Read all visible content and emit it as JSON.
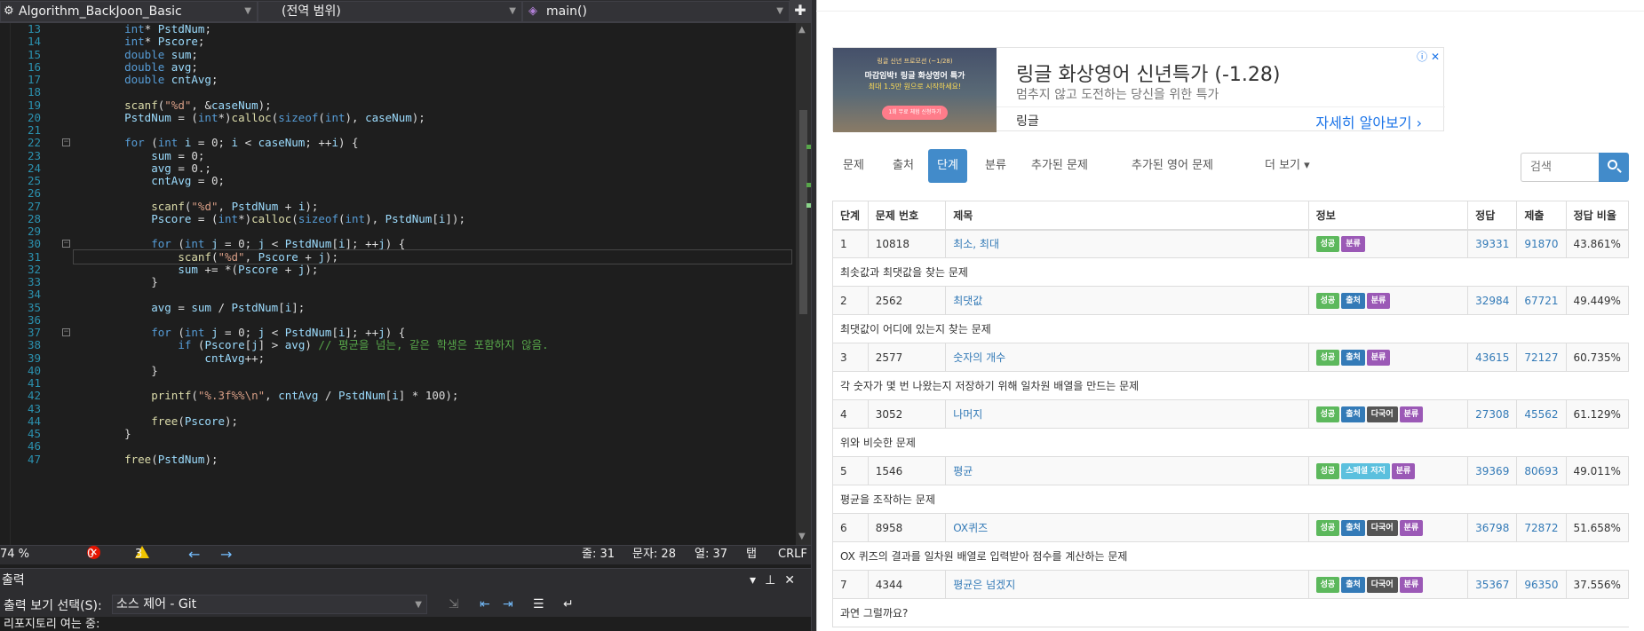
{
  "ide": {
    "nav": {
      "project": "Algorithm_BackJoon_Basic",
      "scope": "(전역 범위)",
      "func": "main()"
    },
    "code_lines": [
      {
        "n": "13",
        "t": "    int* PstdNum;"
      },
      {
        "n": "14",
        "t": "    int* Pscore;"
      },
      {
        "n": "15",
        "t": "    double sum;"
      },
      {
        "n": "16",
        "t": "    double avg;"
      },
      {
        "n": "17",
        "t": "    double cntAvg;"
      },
      {
        "n": "18",
        "t": ""
      },
      {
        "n": "19",
        "t": "    scanf(\"%d\", &caseNum);"
      },
      {
        "n": "20",
        "t": "    PstdNum = (int*)calloc(sizeof(int), caseNum);"
      },
      {
        "n": "21",
        "t": ""
      },
      {
        "n": "22",
        "t": "    for (int i = 0; i < caseNum; ++i) {"
      },
      {
        "n": "23",
        "t": "        sum = 0;"
      },
      {
        "n": "24",
        "t": "        avg = 0.;"
      },
      {
        "n": "25",
        "t": "        cntAvg = 0;"
      },
      {
        "n": "26",
        "t": ""
      },
      {
        "n": "27",
        "t": "        scanf(\"%d\", PstdNum + i);"
      },
      {
        "n": "28",
        "t": "        Pscore = (int*)calloc(sizeof(int), PstdNum[i]);"
      },
      {
        "n": "29",
        "t": ""
      },
      {
        "n": "30",
        "t": "        for (int j = 0; j < PstdNum[i]; ++j) {"
      },
      {
        "n": "31",
        "t": "            scanf(\"%d\", Pscore + j);"
      },
      {
        "n": "32",
        "t": "            sum += *(Pscore + j);"
      },
      {
        "n": "33",
        "t": "        }"
      },
      {
        "n": "34",
        "t": ""
      },
      {
        "n": "35",
        "t": "        avg = sum / PstdNum[i];"
      },
      {
        "n": "36",
        "t": ""
      },
      {
        "n": "37",
        "t": "        for (int j = 0; j < PstdNum[i]; ++j) {"
      },
      {
        "n": "38",
        "t": "            if (Pscore[j] > avg) // 평균을 넘는, 같은 학생은 포함하지 않음."
      },
      {
        "n": "39",
        "t": "                cntAvg++;"
      },
      {
        "n": "40",
        "t": "        }"
      },
      {
        "n": "41",
        "t": ""
      },
      {
        "n": "42",
        "t": "        printf(\"%.3f%%\\n\", cntAvg / PstdNum[i] * 100);"
      },
      {
        "n": "43",
        "t": ""
      },
      {
        "n": "44",
        "t": "        free(Pscore);"
      },
      {
        "n": "45",
        "t": "    }"
      },
      {
        "n": "46",
        "t": ""
      },
      {
        "n": "47",
        "t": "    free(PstdNum);"
      }
    ],
    "status": {
      "zoom": "74 %",
      "errors": "0",
      "warnings": "3",
      "line": "줄: 31",
      "char": "문자: 28",
      "col": "열: 37",
      "tab": "탭",
      "eol": "CRLF"
    },
    "output": {
      "title": "출력",
      "show_label": "출력 보기 선택(S):",
      "source": "소스 제어 - Git",
      "text": "리포지토리 여는 중:"
    }
  },
  "web": {
    "ad": {
      "title": "링글 화상영어 신년특가 (-1.28)",
      "subtitle": "멈추지 않고 도전하는 당신을 위한 특가",
      "brand": "링글",
      "more": "자세히 알아보기",
      "img_line1": "링글 신년 프로모션 (~1/28)",
      "img_line2": "마감임박! 링글 화상영어 특가",
      "img_line3": "최대 1.5만 원으로 시작하세요!",
      "img_btn": "1회 무료 체험 신청하기"
    },
    "tabs": [
      "문제",
      "출처",
      "단계",
      "분류",
      "추가된 문제",
      "추가된 영어 문제",
      "더 보기 ▾"
    ],
    "search_placeholder": "검색",
    "table": {
      "headers": [
        "단계",
        "문제 번호",
        "제목",
        "정보",
        "정답",
        "제출",
        "정답 비율"
      ],
      "rows": [
        {
          "step": "1",
          "num": "10818",
          "title": "최소, 최대",
          "tags": [
            "성공",
            "분류"
          ],
          "ac": "39331",
          "sub": "91870",
          "ratio": "43.861%",
          "desc": "최솟값과 최댓값을 찾는 문제"
        },
        {
          "step": "2",
          "num": "2562",
          "title": "최댓값",
          "tags": [
            "성공",
            "출처",
            "분류"
          ],
          "ac": "32984",
          "sub": "67721",
          "ratio": "49.449%",
          "desc": "최댓값이 어디에 있는지 찾는 문제"
        },
        {
          "step": "3",
          "num": "2577",
          "title": "숫자의 개수",
          "tags": [
            "성공",
            "출처",
            "분류"
          ],
          "ac": "43615",
          "sub": "72127",
          "ratio": "60.735%",
          "desc": "각 숫자가 몇 번 나왔는지 저장하기 위해 일차원 배열을 만드는 문제"
        },
        {
          "step": "4",
          "num": "3052",
          "title": "나머지",
          "tags": [
            "성공",
            "출처",
            "다국어",
            "분류"
          ],
          "ac": "27308",
          "sub": "45562",
          "ratio": "61.129%",
          "desc": "위와 비슷한 문제"
        },
        {
          "step": "5",
          "num": "1546",
          "title": "평균",
          "tags": [
            "성공",
            "스페셜 저지",
            "분류"
          ],
          "ac": "39369",
          "sub": "80693",
          "ratio": "49.011%",
          "desc": "평균을 조작하는 문제"
        },
        {
          "step": "6",
          "num": "8958",
          "title": "OX퀴즈",
          "tags": [
            "성공",
            "출처",
            "다국어",
            "분류"
          ],
          "ac": "36798",
          "sub": "72872",
          "ratio": "51.658%",
          "desc": "OX 퀴즈의 결과를 일차원 배열로 입력받아 점수를 계산하는 문제"
        },
        {
          "step": "7",
          "num": "4344",
          "title": "평균은 넘겠지",
          "tags": [
            "성공",
            "출처",
            "다국어",
            "분류"
          ],
          "ac": "35367",
          "sub": "96350",
          "ratio": "37.556%",
          "desc": "과연 그럴까요?"
        }
      ]
    }
  }
}
